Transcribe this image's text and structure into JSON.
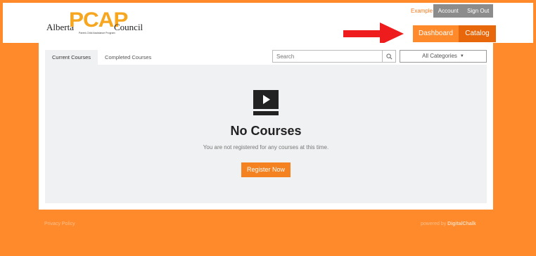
{
  "header": {
    "logo": {
      "alberta": "Alberta",
      "pcap": "PCAP",
      "council": "Council",
      "tagline": "Parent-Child Assistance Program"
    },
    "user_link": "Example User",
    "account_label": "Account",
    "signout_label": "Sign Out",
    "nav": {
      "dashboard": "Dashboard",
      "catalog": "Catalog"
    }
  },
  "course_tabs": [
    "Current Courses",
    "Completed Courses"
  ],
  "search": {
    "placeholder": "Search",
    "icon": "search-icon"
  },
  "categories": {
    "selected": "All Categories"
  },
  "empty_state": {
    "icon": "play-video-icon",
    "heading": "No Courses",
    "message": "You are not registered for any courses at this time.",
    "button": "Register Now"
  },
  "footer": {
    "privacy": "Privacy Policy",
    "powered_by": "powered by",
    "vendor": "DigitalChalk"
  },
  "colors": {
    "brand_orange": "#ff8a2c",
    "active_nav": "#e8670a",
    "button_orange": "#f58220",
    "annotation_arrow": "#ee1c1c",
    "account_bar": "#8c8c8c"
  }
}
